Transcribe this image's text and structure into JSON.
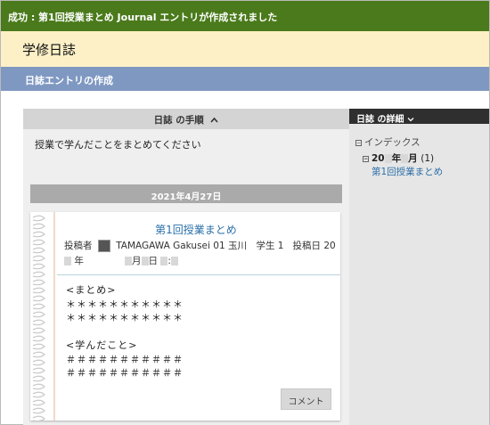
{
  "notification": {
    "text": "成功 : 第1回授業まとめ Journal エントリが作成されました"
  },
  "header": {
    "title": "学修日誌"
  },
  "subheader": {
    "title": "日誌エントリの作成"
  },
  "steps": {
    "heading": "日誌 の手順",
    "toggle_icon": "chevron-up-icon",
    "instruction": "授業で学んだことをまとめてください"
  },
  "entry": {
    "date": "2021年4月27日",
    "title": "第1回授業まとめ",
    "meta_prefix": "投稿者",
    "author": "TAMAGAWA Gakusei 01 玉川　学生 1",
    "posted_label": "投稿日 20",
    "year_suffix": "年",
    "month_label": "月",
    "day_label": "日",
    "colon": ":",
    "body": "<まとめ>\n＊＊＊＊＊＊＊＊＊＊＊\n＊＊＊＊＊＊＊＊＊＊＊\n\n<学んだこと>\n＃＃＃＃＃＃＃＃＃＃＃\n＃＃＃＃＃＃＃＃＃＃＃",
    "comment_button": "コメント"
  },
  "sidebar": {
    "heading": "日誌 の詳細",
    "heading_icon": "chevron-down-icon",
    "index_label": "インデックス",
    "month_prefix": "20",
    "month_mid": "年",
    "month_suffix": "月",
    "month_count": "(1)",
    "entry_link": "第1回授業まとめ"
  },
  "colors": {
    "success": "#4a7a1b",
    "title_bg": "#fdf0c7",
    "subtitle_bg": "#7f98c2",
    "link": "#2a6fa8"
  }
}
